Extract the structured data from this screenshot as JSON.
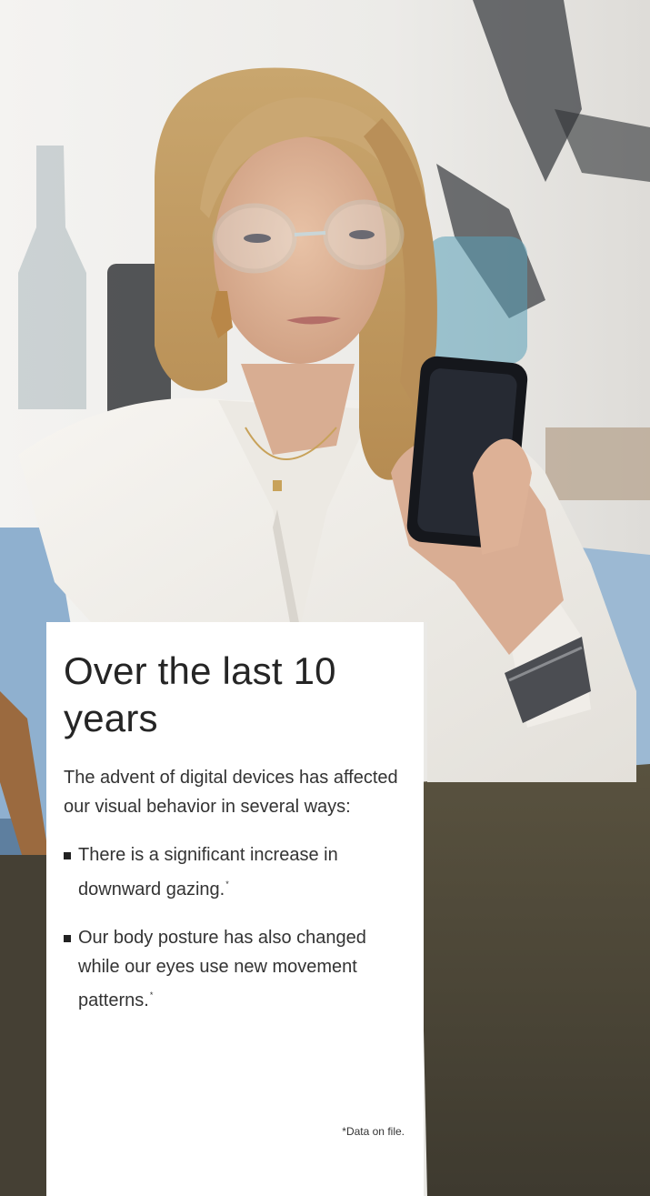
{
  "card": {
    "title": "Over the last 10 years",
    "intro": "The advent of digital devices has affected our visual behavior in several ways:",
    "bullets": [
      {
        "text": "There is a significant increase in downward gazing.",
        "mark": "*"
      },
      {
        "text": "Our body posture has also changed while our eyes use new movement patterns.",
        "mark": "*"
      }
    ],
    "footnote": "*Data on file."
  },
  "photo": {
    "icon": "woman-looking-at-smartphone-photo"
  },
  "colors": {
    "card_background": "#ffffff",
    "text": "#333333",
    "shirt": "#f2efe9",
    "sofa": "#8fb0cf"
  }
}
